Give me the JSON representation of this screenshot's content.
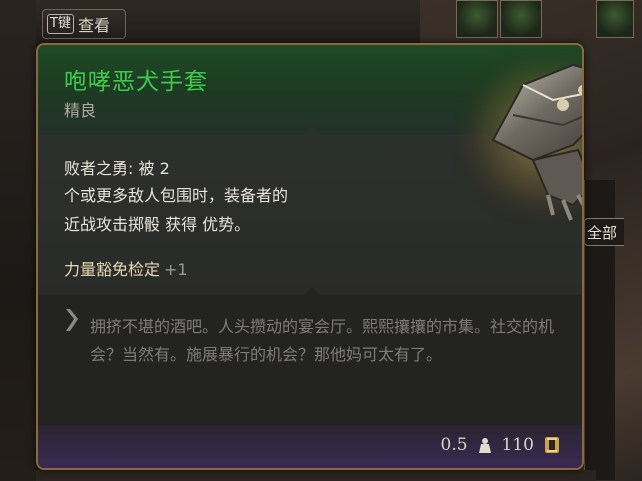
{
  "view_button": {
    "key": "T键",
    "label": "查看"
  },
  "side_panel": {
    "label": "全部"
  },
  "item": {
    "name": "咆哮恶犬手套",
    "rarity": "精良",
    "rarity_color": "#41c94f",
    "passive": {
      "title": "败者之勇: 被 2",
      "line1": "个或更多敌人包围时，装备者的",
      "line2": "近战攻击掷骰 获得 优势。"
    },
    "save": {
      "label": "力量豁免检定",
      "bonus": "+1"
    },
    "flavor": "拥挤不堪的酒吧。人头攒动的宴会厅。熙熙攘攘的市集。社交的机会？当然有。施展暴行的机会？那他妈可太有了。",
    "weight": "0.5",
    "weight_icon": "weight-icon",
    "value": "110",
    "value_icon": "gold-coin-icon"
  }
}
